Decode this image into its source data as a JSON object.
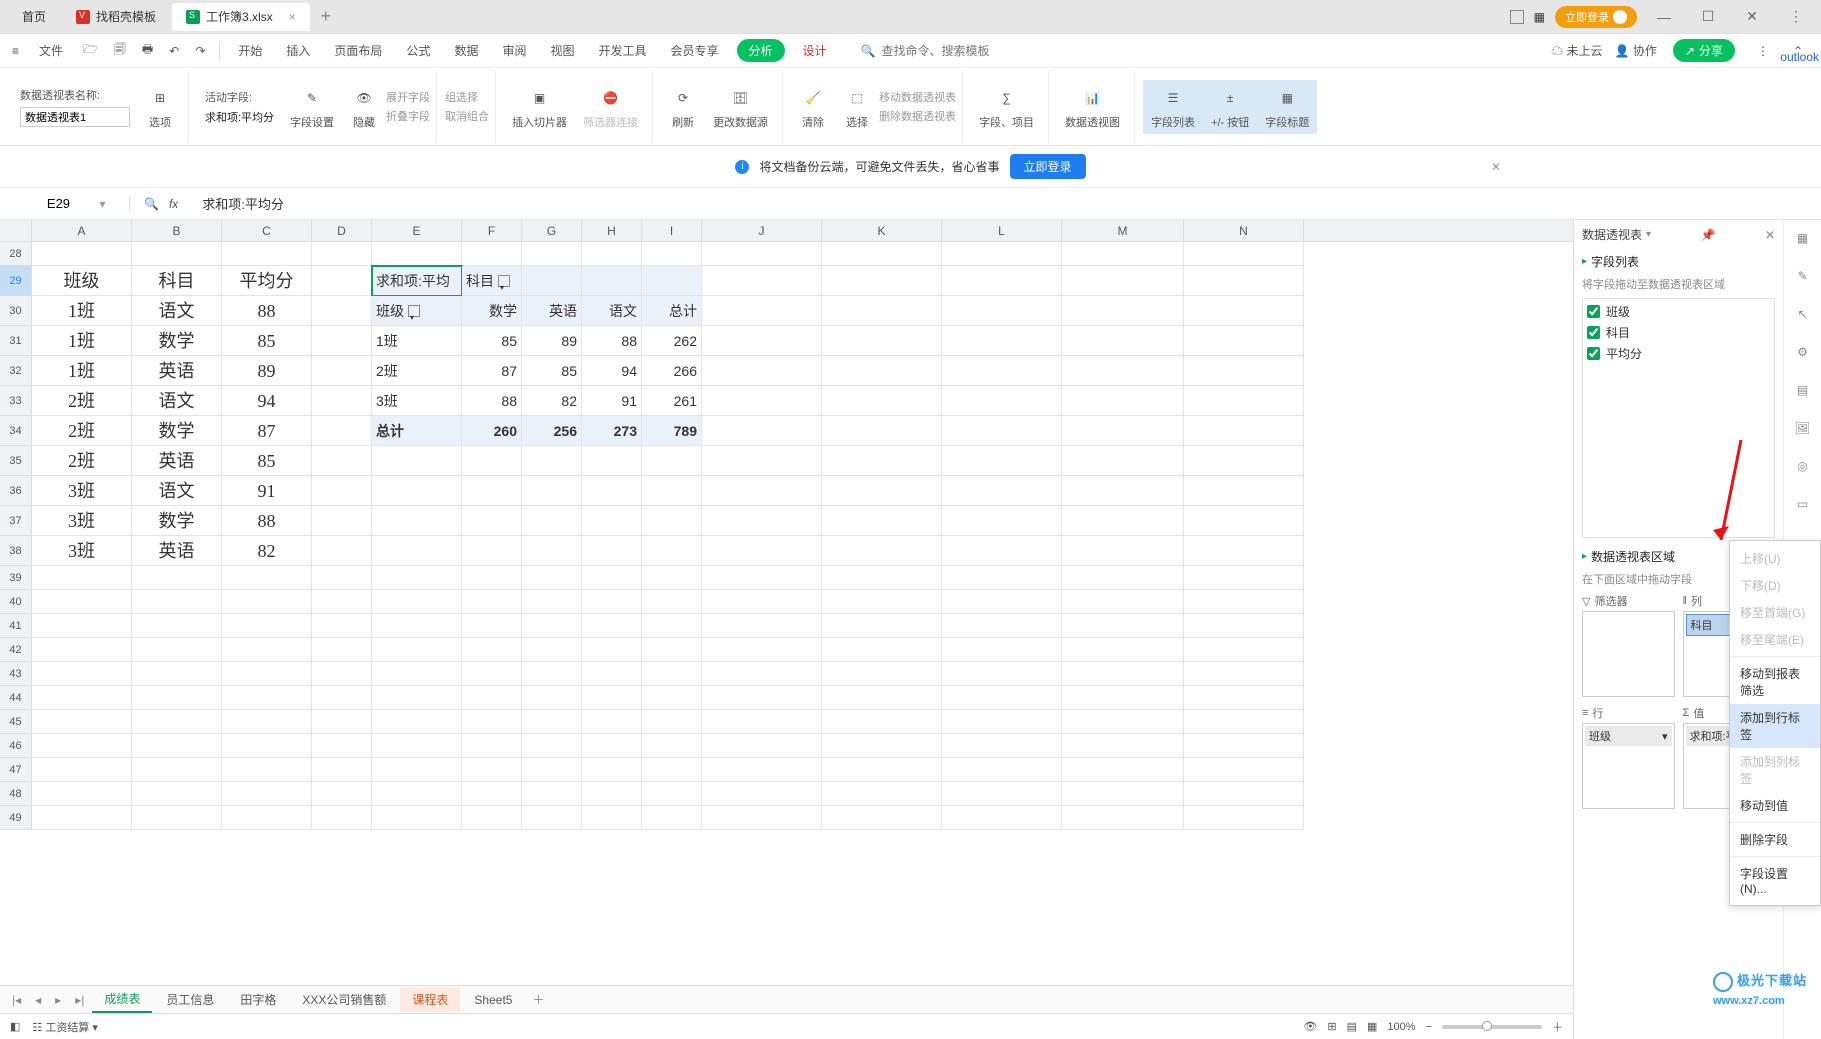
{
  "titlebar": {
    "home": "首页",
    "docer": "找稻壳模板",
    "workbook": "工作簿3.xlsx",
    "login_pill": "立即登录"
  },
  "outlook_label": "outlook",
  "menubar": {
    "file": "文件",
    "start": "开始",
    "insert": "插入",
    "page_layout": "页面布局",
    "formula": "公式",
    "data": "数据",
    "review": "审阅",
    "view": "视图",
    "dev": "开发工具",
    "member": "会员专享",
    "analyze": "分析",
    "design": "设计",
    "search_hint": "查找命令、搜索模板",
    "not_cloud": "未上云",
    "coop": "协作",
    "share": "分享"
  },
  "ribbon": {
    "pivot_name_label": "数据透视表名称:",
    "pivot_name_value": "数据透视表1",
    "opts": "选项",
    "active_field_label": "活动字段:",
    "active_field_value": "求和项:平均分",
    "field_settings": "字段设置",
    "hide": "隐藏",
    "expand_field": "展开字段",
    "collapse_field": "折叠字段",
    "group_sel": "组选择",
    "ungroup": "取消组合",
    "insert_slicer": "插入切片器",
    "filter_conn": "筛选器连接",
    "refresh": "刷新",
    "change_ds": "更改数据源",
    "clear": "清除",
    "select": "选择",
    "move_pivot": "移动数据透视表",
    "delete_pivot": "删除数据透视表",
    "fields_items": "字段、项目",
    "pivot_chart": "数据透视图",
    "field_list": "字段列表",
    "plus_minus": "+/- 按钮",
    "field_headers": "字段标题"
  },
  "msgbar": {
    "text": "将文档备份云端，可避免文件丢失，省心省事",
    "btn": "立即登录"
  },
  "formulabar": {
    "cell": "E29",
    "formula": "求和项:平均分"
  },
  "columns": [
    "A",
    "B",
    "C",
    "D",
    "E",
    "F",
    "G",
    "H",
    "I",
    "J",
    "K",
    "L",
    "M",
    "N"
  ],
  "left_table": {
    "headers": [
      "班级",
      "科目",
      "平均分"
    ],
    "rows": [
      [
        "1班",
        "语文",
        "88"
      ],
      [
        "1班",
        "数学",
        "85"
      ],
      [
        "1班",
        "英语",
        "89"
      ],
      [
        "2班",
        "语文",
        "94"
      ],
      [
        "2班",
        "数学",
        "87"
      ],
      [
        "2班",
        "英语",
        "85"
      ],
      [
        "3班",
        "语文",
        "91"
      ],
      [
        "3班",
        "数学",
        "88"
      ],
      [
        "3班",
        "英语",
        "82"
      ]
    ]
  },
  "pivot": {
    "measure": "求和项:平均分",
    "col_field": "科目",
    "row_field": "班级",
    "col_labels": [
      "数学",
      "英语",
      "语文",
      "总计"
    ],
    "rows": [
      {
        "label": "1班",
        "vals": [
          "85",
          "89",
          "88",
          "262"
        ]
      },
      {
        "label": "2班",
        "vals": [
          "87",
          "85",
          "94",
          "266"
        ]
      },
      {
        "label": "3班",
        "vals": [
          "88",
          "82",
          "91",
          "261"
        ]
      }
    ],
    "grand": {
      "label": "总计",
      "vals": [
        "260",
        "256",
        "273",
        "789"
      ]
    }
  },
  "pivot_pane": {
    "title": "数据透视表",
    "fields_title": "字段列表",
    "fields_hint": "将字段拖动至数据透视表区域",
    "fields": [
      "班级",
      "科目",
      "平均分"
    ],
    "areas_title": "数据透视表区域",
    "areas_hint": "在下面区域中拖动字段",
    "filter_lab": "筛选器",
    "col_lab": "列",
    "row_lab": "行",
    "val_lab": "值",
    "col_item": "科目",
    "row_item": "班级",
    "val_item": "求和项:平均分"
  },
  "ctx_menu": {
    "up": "上移(U)",
    "down": "下移(D)",
    "to_first": "移至首端(G)",
    "to_last": "移至尾端(E)",
    "to_filter": "移动到报表筛选",
    "to_row": "添加到行标签",
    "to_col": "添加到列标签",
    "to_val": "移动到值",
    "del": "删除字段",
    "settings": "字段设置(N)..."
  },
  "sheet_tabs": {
    "t1": "成绩表",
    "t2": "员工信息",
    "t3": "田字格",
    "t4": "XXX公司销售额",
    "t5": "课程表",
    "t6": "Sheet5"
  },
  "statusbar": {
    "salary": "工资结算",
    "zoom": "100%"
  },
  "watermark": "极光下载站\nwww.xz7.com"
}
